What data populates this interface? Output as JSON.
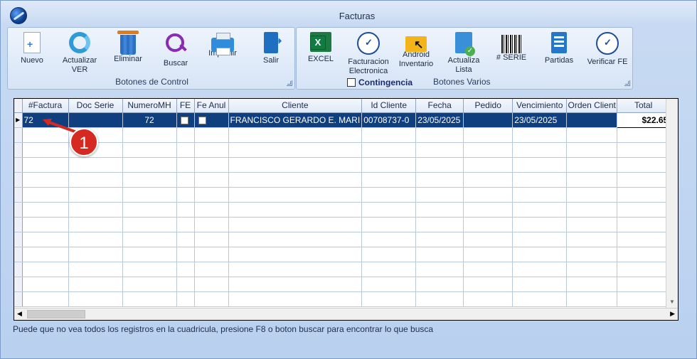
{
  "window": {
    "title": "Facturas"
  },
  "control_group": {
    "label": "Botones de Control",
    "buttons": [
      {
        "label": "Nuevo",
        "icon": "new-document-icon"
      },
      {
        "label": "Actualizar VER",
        "icon": "refresh-icon"
      },
      {
        "label": "Eliminar",
        "icon": "trash-icon"
      },
      {
        "label": "Buscar",
        "icon": "search-icon"
      },
      {
        "label": "Imprimir",
        "icon": "printer-icon"
      },
      {
        "label": "Salir",
        "icon": "exit-icon"
      }
    ]
  },
  "varios_group": {
    "label": "Botones Varios",
    "contingencia_label": "Contingencia",
    "buttons": [
      {
        "label": "EXCEL",
        "icon": "excel-icon"
      },
      {
        "label": "Facturacion Electronica",
        "icon": "electronic-invoice-seal-icon"
      },
      {
        "label": "Android Inventario",
        "icon": "android-folder-icon"
      },
      {
        "label": "Actualiza Lista",
        "icon": "update-list-icon"
      },
      {
        "label": "# SERIE",
        "icon": "barcode-icon"
      },
      {
        "label": "Partidas",
        "icon": "partidas-icon"
      },
      {
        "label": "Verificar FE",
        "icon": "verify-seal-icon"
      }
    ]
  },
  "grid": {
    "columns": [
      "#Factura",
      "Doc Serie",
      "NumeroMH",
      "FE",
      "Fe Anul",
      "Cliente",
      "Id Cliente",
      "Fecha",
      "Pedido",
      "Vencimiento",
      "Orden Client",
      "Total"
    ],
    "rows": [
      {
        "factura": "72",
        "doc_serie": "",
        "numero_mh": "72",
        "fe": false,
        "fe_anul": false,
        "cliente": "FRANCISCO GERARDO E. MARI",
        "id_cliente": "00708737-0",
        "fecha": "23/05/2025",
        "pedido": "",
        "vencimiento": "23/05/2025",
        "orden_client": "",
        "total": "$22.65"
      }
    ]
  },
  "status_text": "Puede que no vea todos los registros en la cuadricula, presione F8 o boton buscar para encontrar lo que busca",
  "annotation": {
    "number": "1",
    "color": "#d42a22"
  },
  "colors": {
    "selection": "#0f3f7e",
    "window_bg": "#c9dbf3"
  }
}
